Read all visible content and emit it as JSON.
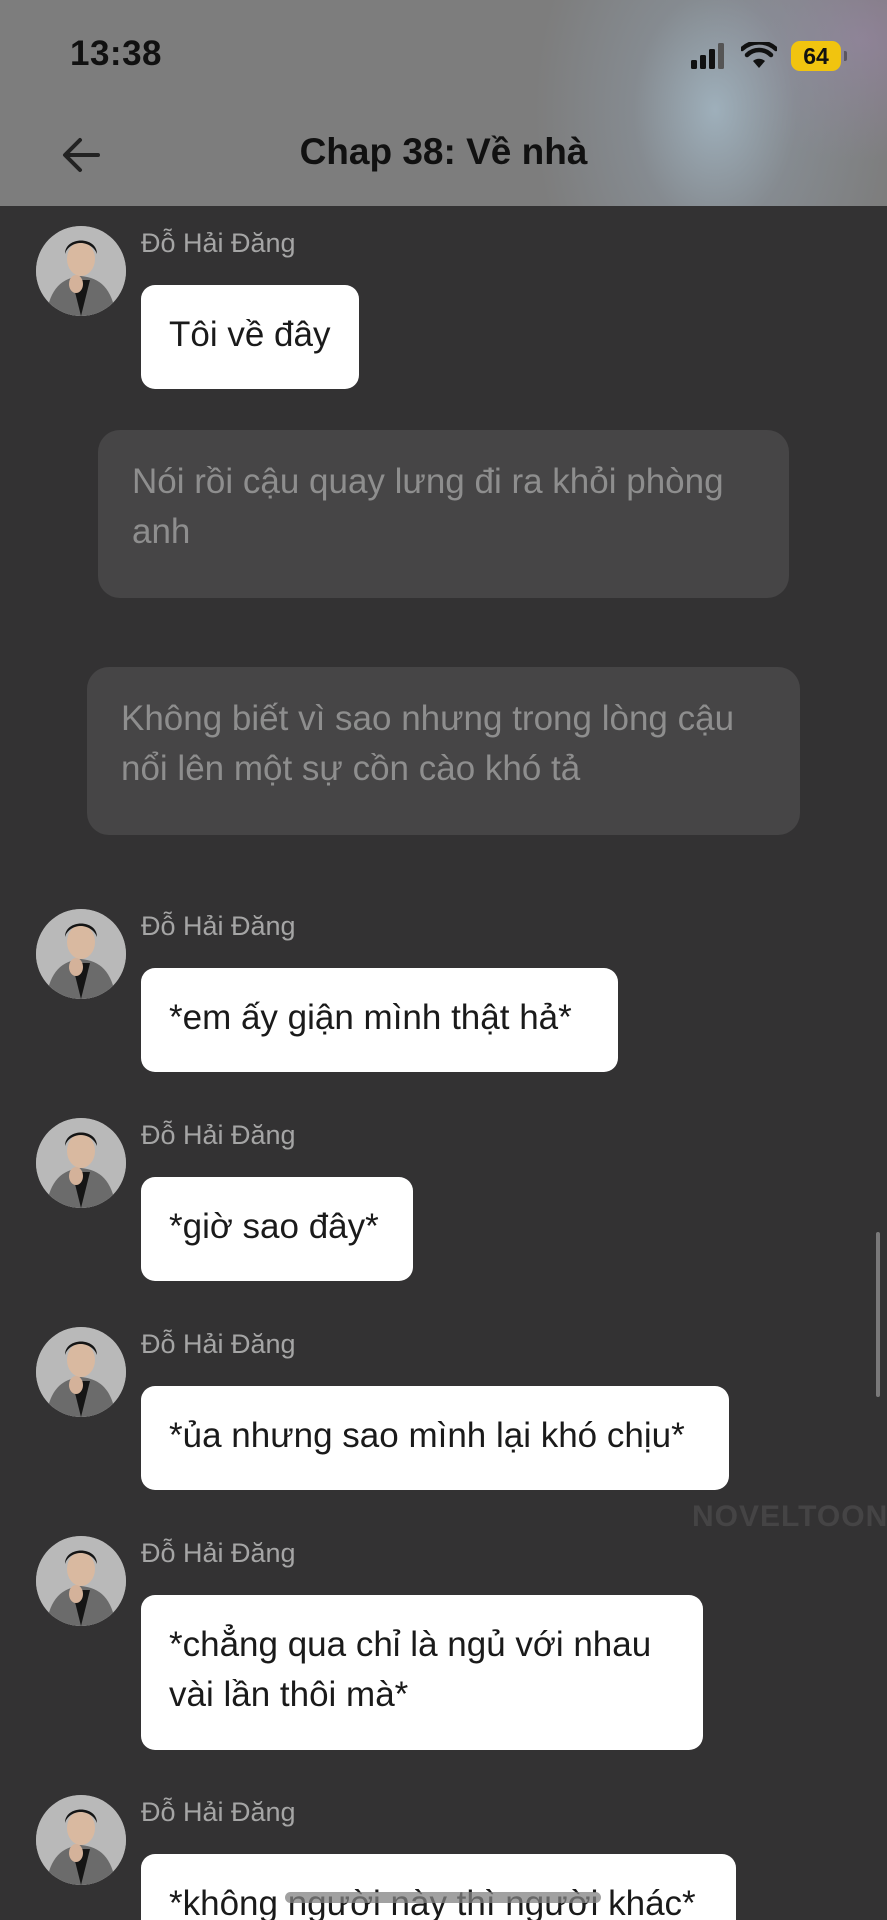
{
  "status_bar": {
    "time": "13:38",
    "battery": "64"
  },
  "header": {
    "title": "Chap 38: Về nhà"
  },
  "watermark": "NOVELTOON",
  "messages": [
    {
      "sender": "Đỗ Hải Đăng",
      "text": "Tôi về đây"
    },
    {
      "narration": "Nói rồi cậu quay lưng đi ra khỏi phòng anh"
    },
    {
      "narration": "Không biết vì sao nhưng trong lòng cậu nổi lên một sự cồn cào khó tả"
    },
    {
      "sender": "Đỗ Hải Đăng",
      "text": "*em ấy giận mình thật hả*"
    },
    {
      "sender": "Đỗ Hải Đăng",
      "text": "*giờ sao đây*"
    },
    {
      "sender": "Đỗ Hải Đăng",
      "text": "*ủa nhưng sao mình lại khó chịu*"
    },
    {
      "sender": "Đỗ Hải Đăng",
      "text": "*chẳng qua chỉ là ngủ với nhau vài lần thôi mà*"
    },
    {
      "sender": "Đỗ Hải Đăng",
      "text": "*không người này thì người khác*"
    }
  ]
}
